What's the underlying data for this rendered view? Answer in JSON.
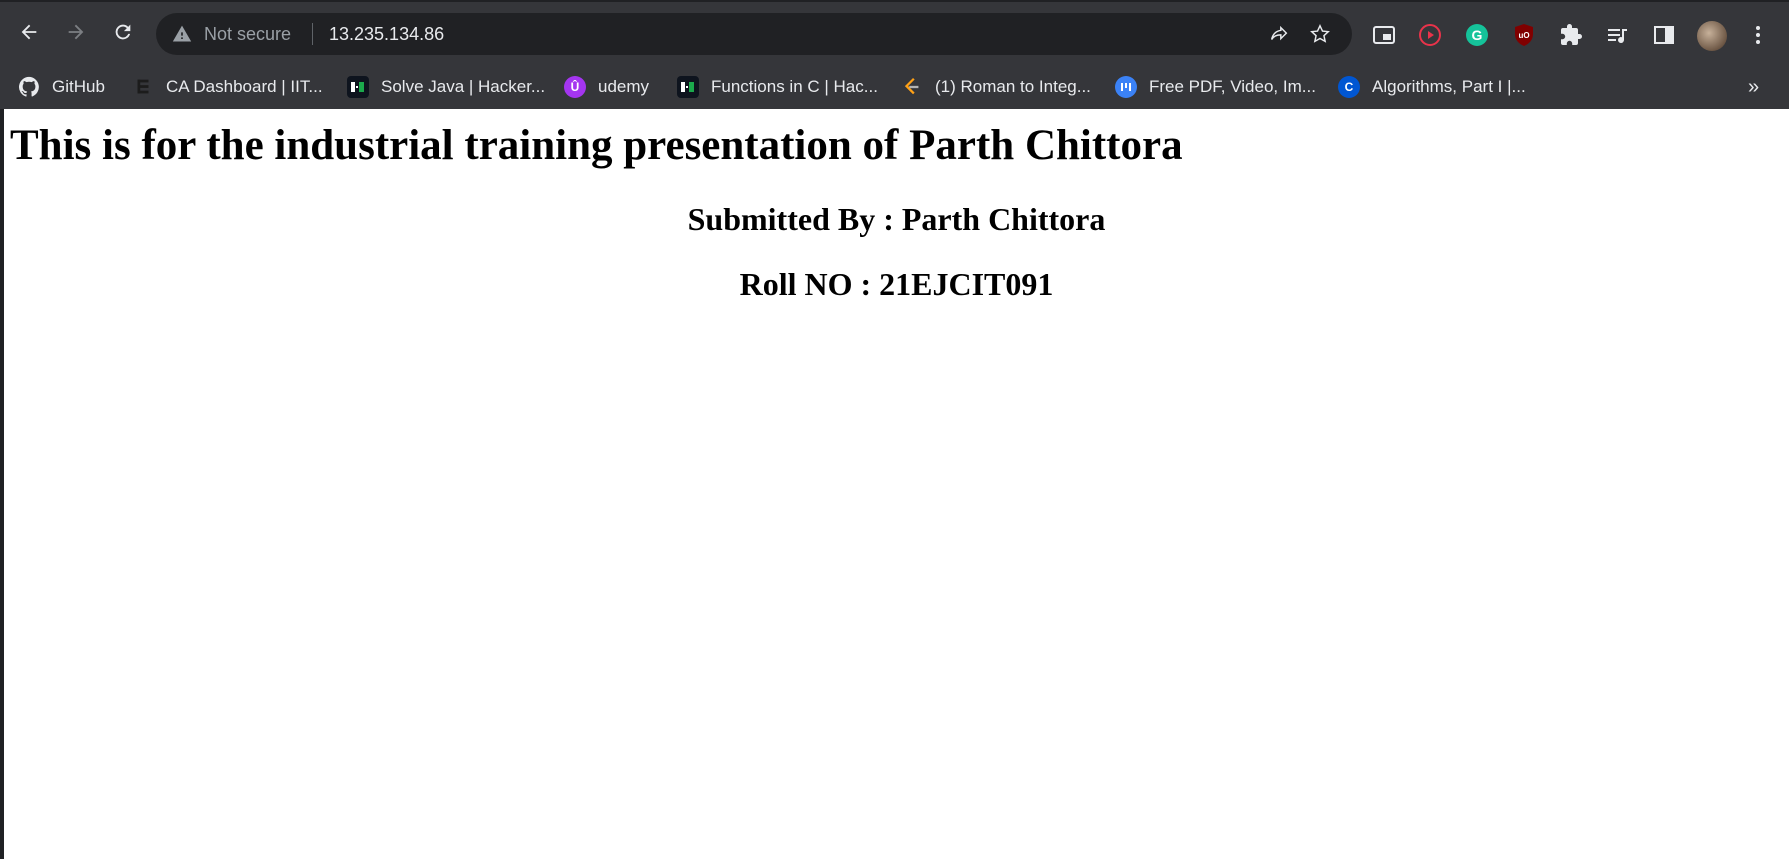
{
  "browser": {
    "security_label": "Not secure",
    "url": "13.235.134.86"
  },
  "bookmarks": [
    {
      "label": "GitHub",
      "icon": "github-icon"
    },
    {
      "label": "CA Dashboard | IIT...",
      "icon": "ca-dashboard-icon"
    },
    {
      "label": "Solve Java | Hacker...",
      "icon": "hackerrank-icon"
    },
    {
      "label": "udemy",
      "icon": "udemy-icon"
    },
    {
      "label": "Functions in C | Hac...",
      "icon": "hackerrank-icon"
    },
    {
      "label": "(1) Roman to Integ...",
      "icon": "leetcode-icon"
    },
    {
      "label": "Free PDF, Video, Im...",
      "icon": "pdf-tool-icon"
    },
    {
      "label": "Algorithms, Part I |...",
      "icon": "coursera-icon"
    }
  ],
  "bookmarks_overflow": "»",
  "page": {
    "heading": "This is for the industrial training presentation of Parth Chittora",
    "submitted_by": "Submitted By : Parth Chittora",
    "roll_no": "Roll NO : 21EJCIT091"
  }
}
